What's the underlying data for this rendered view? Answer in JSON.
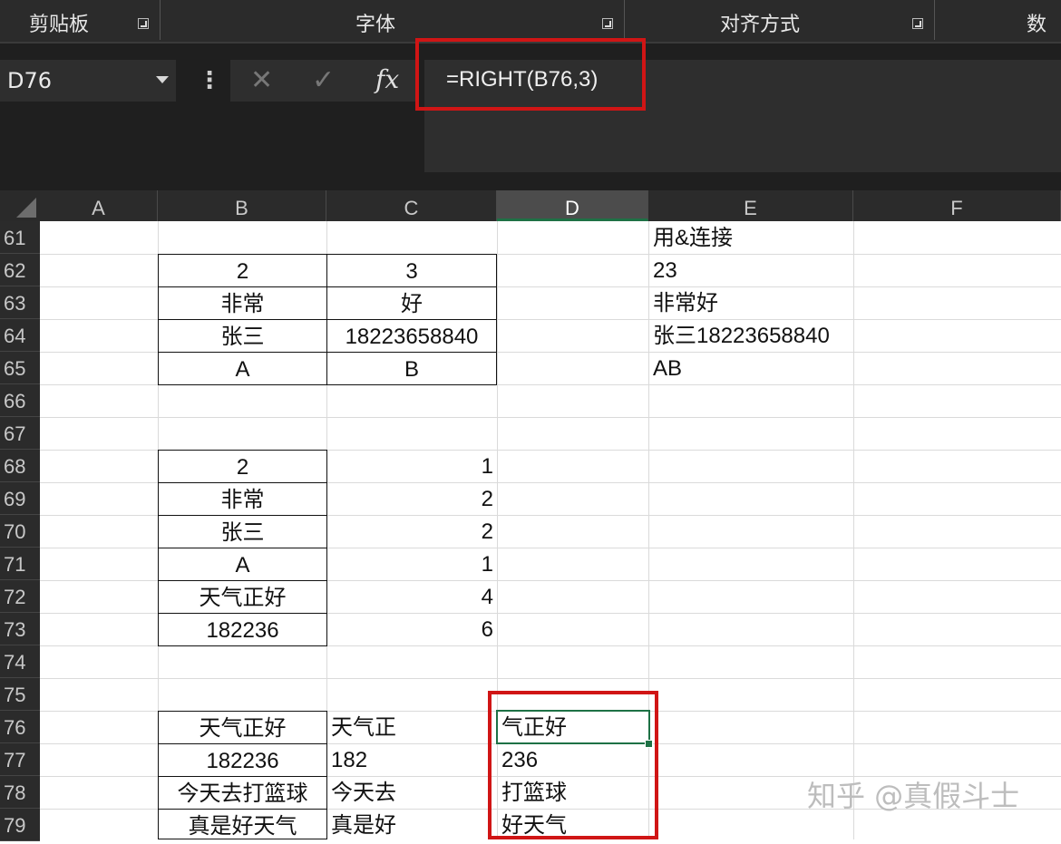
{
  "ribbon": {
    "groups": [
      "剪贴板",
      "字体",
      "对齐方式",
      "数字"
    ]
  },
  "formula_bar": {
    "name_box": "D76",
    "formula": "=RIGHT(B76,3)",
    "fx_label": "fx",
    "cancel_icon": "✕",
    "enter_icon": "✓",
    "menu_dots": "⋮"
  },
  "columns": [
    "A",
    "B",
    "C",
    "D",
    "E",
    "F"
  ],
  "rows": [
    "61",
    "62",
    "63",
    "64",
    "65",
    "66",
    "67",
    "68",
    "69",
    "70",
    "71",
    "72",
    "73",
    "74",
    "75",
    "76",
    "77",
    "78",
    "79"
  ],
  "cells": {
    "E61": "用&连接",
    "B62": "2",
    "C62": "3",
    "E62": "23",
    "B63": "非常",
    "C63": "好",
    "E63": "非常好",
    "B64": "张三",
    "C64": "18223658840",
    "E64": "张三18223658840",
    "B65": "A",
    "C65": "B",
    "E65": "AB",
    "B68": "2",
    "C68": "1",
    "B69": "非常",
    "C69": "2",
    "B70": "张三",
    "C70": "2",
    "B71": "A",
    "C71": "1",
    "B72": "天气正好",
    "C72": "4",
    "B73": "182236",
    "C73": "6",
    "B76": "天气正好",
    "C76": "天气正",
    "D76": "气正好",
    "B77": "182236",
    "C77": "182",
    "D77": "236",
    "B78": "今天去打篮球",
    "C78": "今天去",
    "D78": "打篮球",
    "B79": "真是好天气",
    "C79": "真是好",
    "D79": "好天气"
  },
  "selected_cell": "D76",
  "selected_column": "D",
  "watermark": "知乎 @真假斗士",
  "colors": {
    "accent_green": "#1e7145",
    "highlight_red": "#d01515"
  }
}
